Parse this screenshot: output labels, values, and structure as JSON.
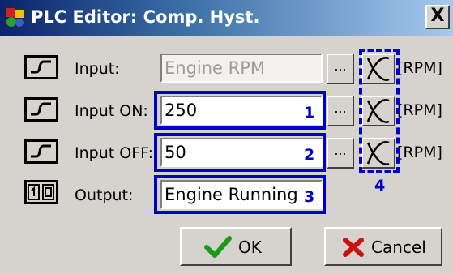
{
  "window": {
    "title": "PLC Editor: Comp. Hyst.",
    "close_label": "X"
  },
  "rows": [
    {
      "label": "Input:",
      "value": "Engine RPM",
      "unit": "[RPM]",
      "disabled": true
    },
    {
      "label": "Input ON:",
      "value": "250",
      "unit": "[RPM]",
      "annotation": "1"
    },
    {
      "label": "Input OFF:",
      "value": "50",
      "unit": "[RPM]",
      "annotation": "2"
    }
  ],
  "output": {
    "label": "Output:",
    "value": "Engine Running",
    "annotation": "3"
  },
  "browse_label": "...",
  "column_annotation": "4",
  "buttons": {
    "ok": "OK",
    "cancel": "Cancel"
  },
  "colors": {
    "annotation": "#0000cc",
    "titlebar_start": "#0a246a",
    "titlebar_end": "#a6caf0",
    "ok_icon": "#1a9a1a",
    "cancel_icon": "#cc1111"
  },
  "icons": [
    "app-icon",
    "analog-signal-icon",
    "digital-output-icon",
    "curve-icon",
    "check-icon",
    "cross-icon"
  ]
}
